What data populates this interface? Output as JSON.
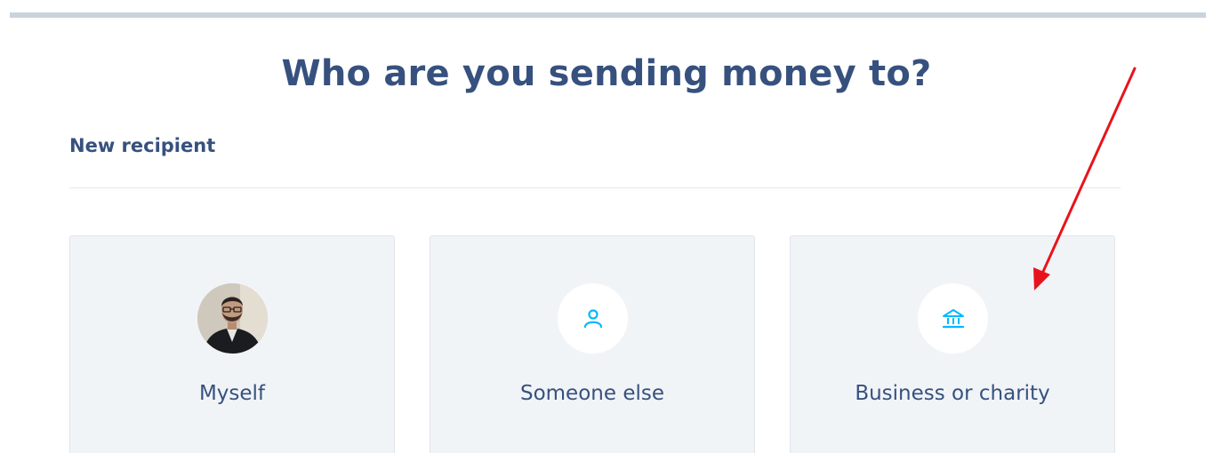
{
  "page": {
    "title": "Who are you sending money to?",
    "section_label": "New recipient"
  },
  "recipient_options": [
    {
      "label": "Myself",
      "icon": "profile-photo"
    },
    {
      "label": "Someone else",
      "icon": "person-icon"
    },
    {
      "label": "Business or charity",
      "icon": "bank-icon"
    }
  ],
  "colors": {
    "heading": "#37517e",
    "accent_icon": "#00b9ff",
    "card_bg": "#f1f4f7",
    "annotation_arrow": "#e8141b"
  }
}
